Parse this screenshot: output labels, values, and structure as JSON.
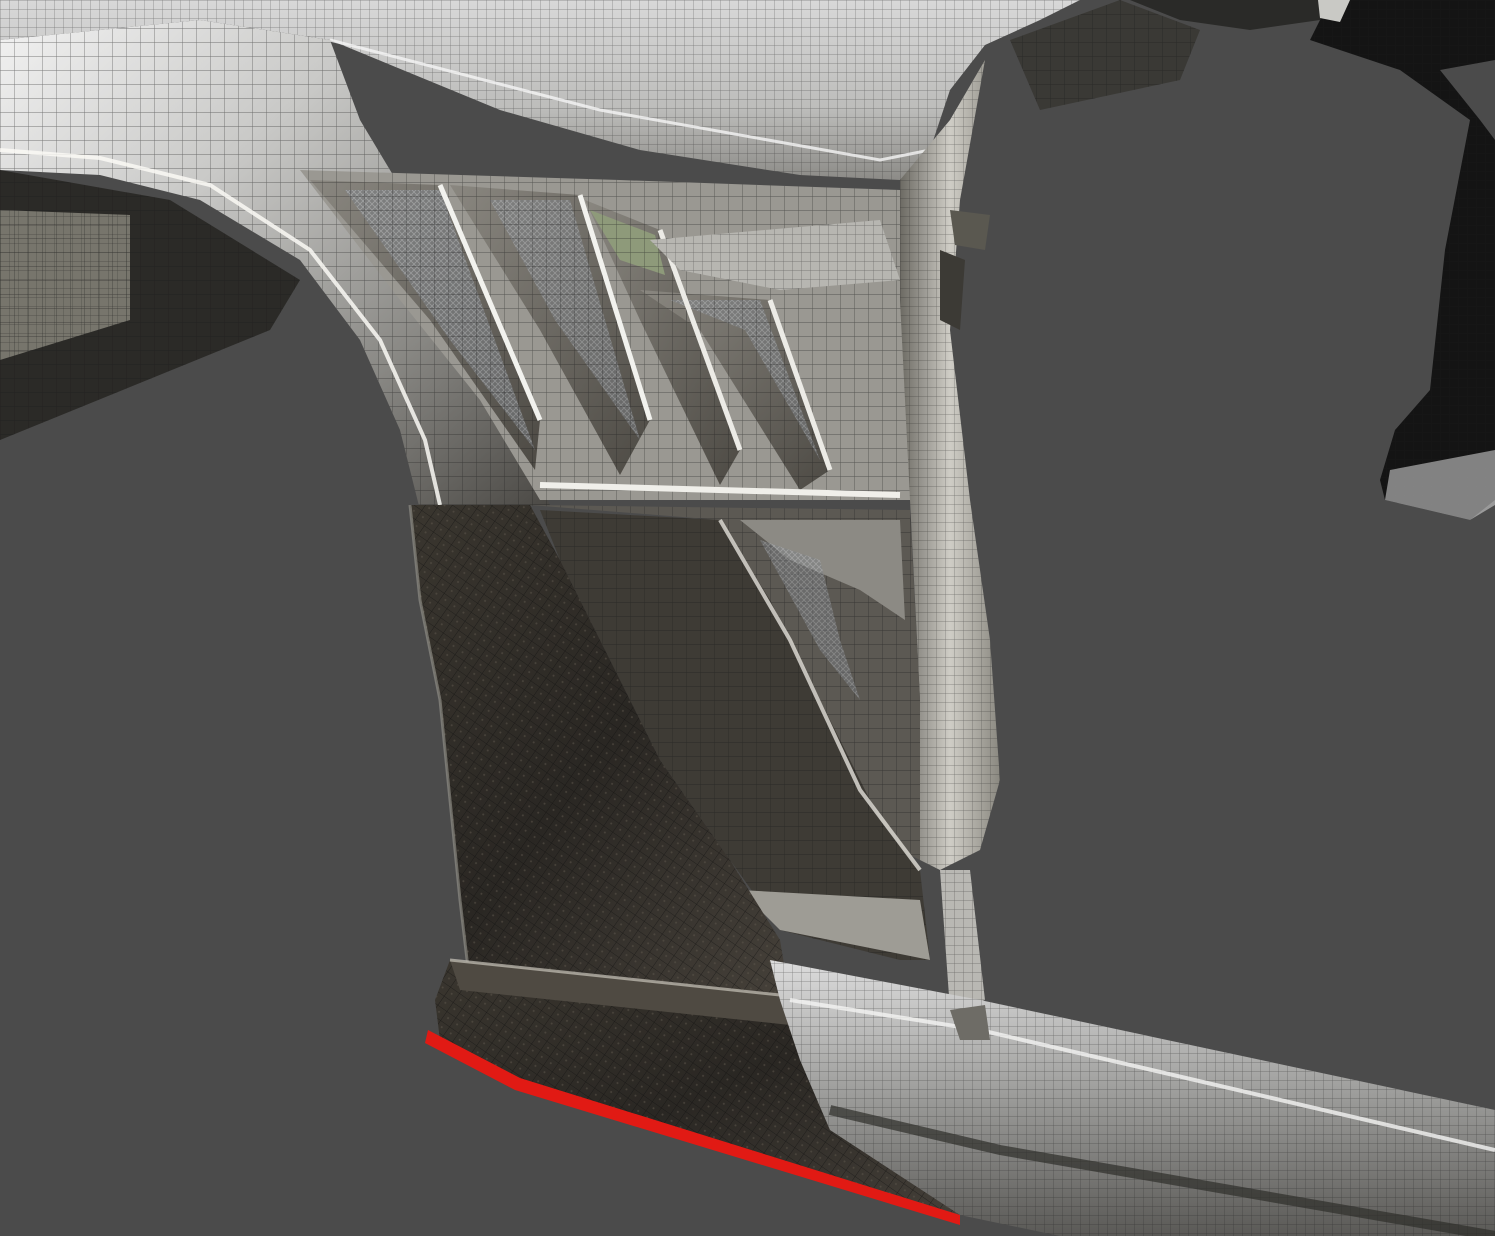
{
  "viewport": {
    "background_color": "#4b4b4b",
    "description_shown": ""
  },
  "model": {
    "palette": {
      "chrome_light": "#e6e6e6",
      "chrome_mid": "#a9a9a9",
      "chrome_dark": "#3c3a36",
      "carbon": "#2a2723",
      "carbon_light": "#4a453d",
      "wire": "#1b1b1b",
      "red_accent": "#e11a14",
      "vent_glass": "#6e6a60",
      "mesh": "#8a8f96",
      "black_part": "#151515"
    },
    "display_mode": "shaded-with-wireframe"
  }
}
